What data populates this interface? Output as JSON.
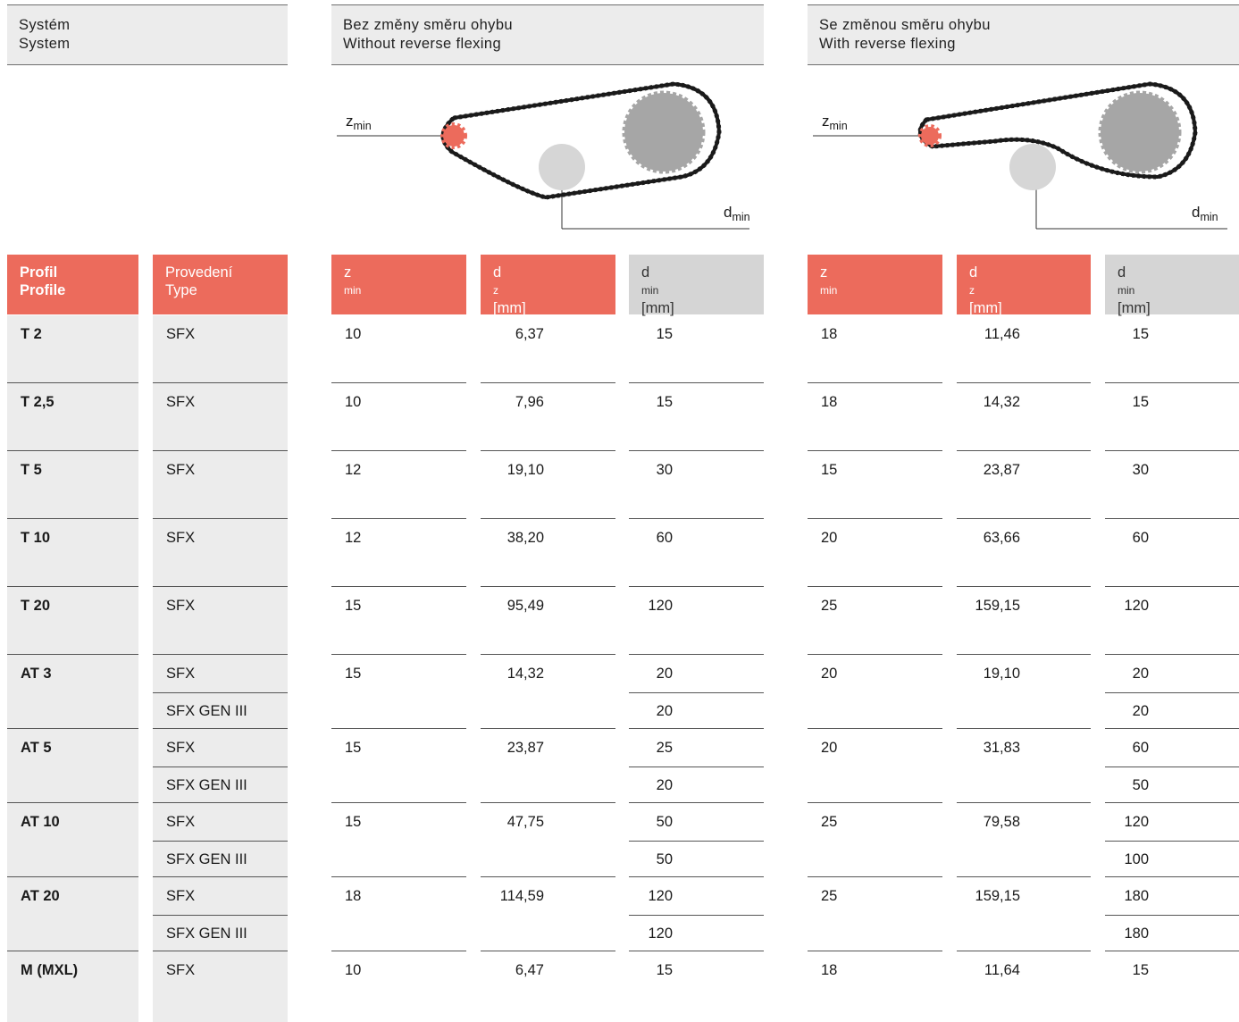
{
  "header": {
    "system": [
      "Systém",
      "System"
    ],
    "no_reverse": [
      "Bez změny směru ohybu",
      "Without reverse flexing"
    ],
    "reverse": [
      "Se změnou směru ohybu",
      "With reverse flexing"
    ]
  },
  "diagram": {
    "z_label": "z",
    "z_sub": "min",
    "d_label": "d",
    "d_sub": "min"
  },
  "columns": {
    "profile": [
      "Profil",
      "Profile"
    ],
    "type": [
      "Provedení",
      "Type"
    ],
    "zmin": {
      "main": "z",
      "sub": "min"
    },
    "dz": {
      "main": "d",
      "sub": "z",
      "unit": "[mm]"
    },
    "dmin": {
      "main": "d",
      "sub": "min",
      "unit": "[mm]"
    }
  },
  "colors": {
    "accent_red": "#ec6b5c",
    "header_grey": "#d5d5d5",
    "band_grey": "#ececec"
  },
  "rows": [
    {
      "profile": "T 2",
      "types": [
        "SFX"
      ],
      "a_z": "10",
      "a_dz": "6,37",
      "a_dmin": [
        "15"
      ],
      "b_z": "18",
      "b_dz": "11,46",
      "b_dmin": [
        "15"
      ]
    },
    {
      "profile": "T 2,5",
      "types": [
        "SFX"
      ],
      "a_z": "10",
      "a_dz": "7,96",
      "a_dmin": [
        "15"
      ],
      "b_z": "18",
      "b_dz": "14,32",
      "b_dmin": [
        "15"
      ]
    },
    {
      "profile": "T 5",
      "types": [
        "SFX"
      ],
      "a_z": "12",
      "a_dz": "19,10",
      "a_dmin": [
        "30"
      ],
      "b_z": "15",
      "b_dz": "23,87",
      "b_dmin": [
        "30"
      ]
    },
    {
      "profile": "T 10",
      "types": [
        "SFX"
      ],
      "a_z": "12",
      "a_dz": "38,20",
      "a_dmin": [
        "60"
      ],
      "b_z": "20",
      "b_dz": "63,66",
      "b_dmin": [
        "60"
      ]
    },
    {
      "profile": "T 20",
      "types": [
        "SFX"
      ],
      "a_z": "15",
      "a_dz": "95,49",
      "a_dmin": [
        "120"
      ],
      "b_z": "25",
      "b_dz": "159,15",
      "b_dmin": [
        "120"
      ]
    },
    {
      "profile": "AT 3",
      "types": [
        "SFX",
        "SFX GEN III"
      ],
      "a_z": "15",
      "a_dz": "14,32",
      "a_dmin": [
        "20",
        "20"
      ],
      "b_z": "20",
      "b_dz": "19,10",
      "b_dmin": [
        "20",
        "20"
      ]
    },
    {
      "profile": "AT 5",
      "types": [
        "SFX",
        "SFX GEN III"
      ],
      "a_z": "15",
      "a_dz": "23,87",
      "a_dmin": [
        "25",
        "20"
      ],
      "b_z": "20",
      "b_dz": "31,83",
      "b_dmin": [
        "60",
        "50"
      ]
    },
    {
      "profile": "AT 10",
      "types": [
        "SFX",
        "SFX GEN III"
      ],
      "a_z": "15",
      "a_dz": "47,75",
      "a_dmin": [
        "50",
        "50"
      ],
      "b_z": "25",
      "b_dz": "79,58",
      "b_dmin": [
        "120",
        "100"
      ]
    },
    {
      "profile": "AT 20",
      "types": [
        "SFX",
        "SFX GEN III"
      ],
      "a_z": "18",
      "a_dz": "114,59",
      "a_dmin": [
        "120",
        "120"
      ],
      "b_z": "25",
      "b_dz": "159,15",
      "b_dmin": [
        "180",
        "180"
      ]
    },
    {
      "profile": "M (MXL)",
      "types": [
        "SFX"
      ],
      "a_z": "10",
      "a_dz": "6,47",
      "a_dmin": [
        "15"
      ],
      "b_z": "18",
      "b_dz": "11,64",
      "b_dmin": [
        "15"
      ]
    }
  ]
}
